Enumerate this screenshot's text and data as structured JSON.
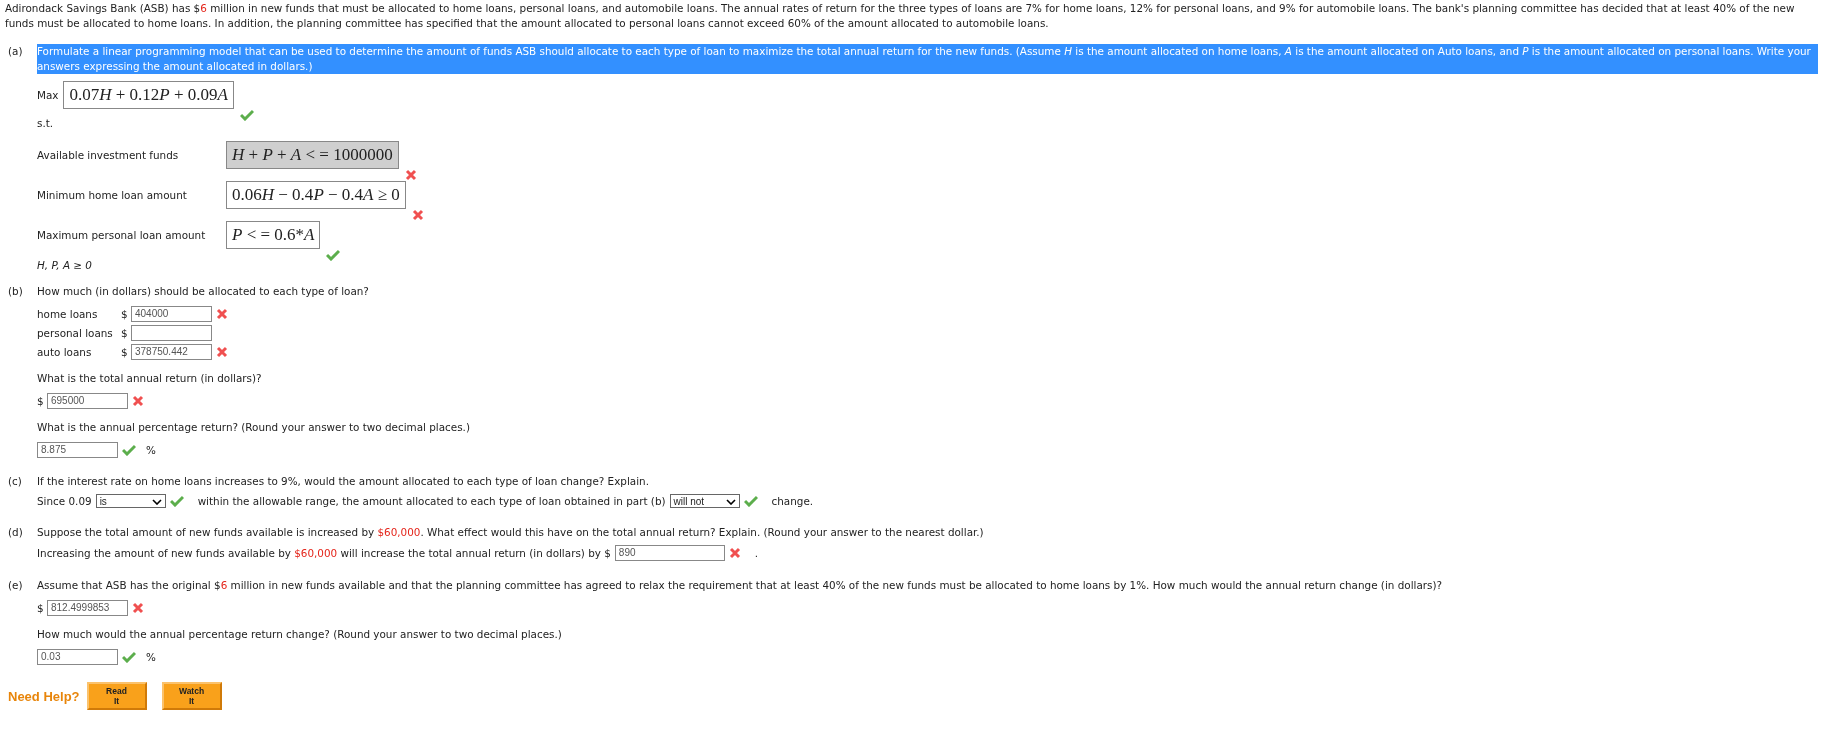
{
  "intro": [
    {
      "kind": "plain",
      "text": "Adirondack Savings Bank (ASB) has $"
    },
    {
      "kind": "given",
      "text": "6"
    },
    {
      "kind": "plain",
      "text": " million in new funds that must be allocated to home loans, personal loans, and automobile loans. The annual rates of return for the three types of loans are 7% for home loans, 12% for personal loans, and 9% for automobile loans. The bank's planning committee has decided that at least 40% of the new funds must be allocated to home loans. In addition, the planning committee has specified that the amount allocated to personal loans cannot exceed 60% of the amount allocated to automobile loans."
    }
  ],
  "parts": [
    {
      "label": "(a)",
      "items": [
        {
          "kind": "prompt",
          "highlighted": true,
          "segments": [
            {
              "kind": "plain",
              "text": "Formulate a linear programming model that can be used to determine the amount of funds ASB should allocate to each type of loan to maximize the total annual return for the new funds. (Assume *H* is the amount allocated on home loans, *A* is the amount allocated on Auto loans, and *P* is the amount allocated on personal loans. Write your answers expressing the amount allocated in dollars.)"
            }
          ]
        },
        {
          "kind": "objective",
          "label": "Max",
          "formula": "0.07H + 0.12P + 0.09A",
          "correct": true,
          "focused": false
        },
        {
          "kind": "text",
          "text": "s.t."
        },
        {
          "kind": "formula",
          "label": "Available investment funds",
          "formula": "H + P + A < = 1000000",
          "correct": false,
          "focused": true
        },
        {
          "kind": "formula",
          "label": "Minimum home loan amount",
          "formula": "0.06H − 0.4P − 0.4A ≥ 0",
          "correct": false,
          "focused": false
        },
        {
          "kind": "formula",
          "label": "Maximum personal loan amount",
          "formula": "P < = 0.6*A",
          "correct": true,
          "focused": false
        },
        {
          "kind": "text",
          "text": "*H*, *P*, *A* ≥ 0"
        }
      ]
    },
    {
      "label": "(b)",
      "items": [
        {
          "kind": "prompt",
          "segments": [
            {
              "kind": "plain",
              "text": "How much (in dollars) should be allocated to each type of loan?"
            }
          ]
        },
        {
          "kind": "amount",
          "label": "home loans",
          "prefix": "$",
          "value": "404000",
          "correct": false
        },
        {
          "kind": "amount",
          "label": "personal loans",
          "prefix": "$"
        },
        {
          "kind": "amount",
          "label": "auto loans",
          "prefix": "$",
          "value": "378750.442",
          "correct": false
        },
        {
          "kind": "prompt",
          "segments": [
            {
              "kind": "plain",
              "text": "What is the total annual return (in dollars)?"
            }
          ]
        },
        {
          "kind": "amount",
          "prefix": "$",
          "value": "695000",
          "correct": false
        },
        {
          "kind": "prompt",
          "segments": [
            {
              "kind": "plain",
              "text": "What is the annual percentage return? (Round your answer to two decimal places.)"
            }
          ]
        },
        {
          "kind": "amount",
          "value": "8.875",
          "correct": true,
          "suffix": "%"
        }
      ]
    },
    {
      "label": "(c)",
      "items": [
        {
          "kind": "prompt",
          "segments": [
            {
              "kind": "plain",
              "text": "If the interest rate on home loans increases to 9%, would the amount allocated to each type of loan change? Explain."
            }
          ]
        },
        {
          "kind": "line",
          "segments": [
            {
              "kind": "text",
              "text": "Since 0.09"
            },
            {
              "kind": "select",
              "value": "is",
              "correct": true
            },
            {
              "kind": "text",
              "text": "within the allowable range, the amount allocated to each type of loan obtained in part (b)"
            },
            {
              "kind": "select",
              "value": "will not",
              "correct": true
            },
            {
              "kind": "text",
              "text": "change."
            }
          ]
        }
      ]
    },
    {
      "label": "(d)",
      "items": [
        {
          "kind": "prompt",
          "segments": [
            {
              "kind": "plain",
              "text": "Suppose the total amount of new funds available is increased by "
            },
            {
              "kind": "given",
              "text": "$60,000"
            },
            {
              "kind": "plain",
              "text": ". What effect would this have on the total annual return? Explain. (Round your answer to the nearest dollar.)"
            }
          ]
        },
        {
          "kind": "line",
          "segments": [
            {
              "kind": "sentence",
              "parts": [
                {
                  "kind": "plain",
                  "text": "Increasing the amount of new funds available by "
                },
                {
                  "kind": "given",
                  "text": "$60,000"
                },
                {
                  "kind": "plain",
                  "text": " will increase the total annual return (in dollars) by $"
                }
              ]
            },
            {
              "kind": "input",
              "value": "890",
              "correct": false
            },
            {
              "kind": "text",
              "text": "."
            }
          ]
        }
      ]
    },
    {
      "label": "(e)",
      "items": [
        {
          "kind": "prompt",
          "segments": [
            {
              "kind": "plain",
              "text": "Assume that ASB has the original $"
            },
            {
              "kind": "given",
              "text": "6"
            },
            {
              "kind": "plain",
              "text": " million in new funds available and that the planning committee has agreed to relax the requirement that at least 40% of the new funds must be allocated to home loans by 1%. How much would the annual return change (in dollars)?"
            }
          ]
        },
        {
          "kind": "amount",
          "prefix": "$",
          "value": "812.4999853",
          "correct": false
        },
        {
          "kind": "prompt",
          "segments": [
            {
              "kind": "plain",
              "text": "How much would the annual percentage return change? (Round your answer to two decimal places.)"
            }
          ]
        },
        {
          "kind": "amount",
          "value": "0.03",
          "correct": true,
          "suffix": "%"
        }
      ]
    }
  ],
  "help": {
    "label": "Need Help?",
    "buttons": [
      "Read It",
      "Watch It"
    ]
  }
}
